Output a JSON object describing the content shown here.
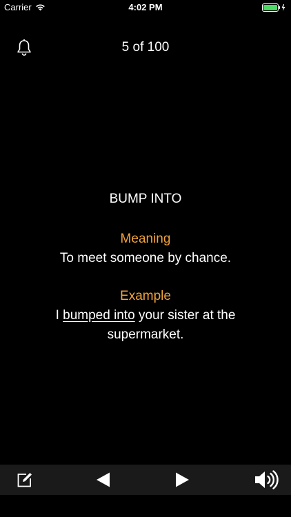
{
  "status_bar": {
    "carrier": "Carrier",
    "time": "4:02 PM",
    "battery_color": "#4cd964"
  },
  "nav": {
    "counter": "5 of 100",
    "left_icon": "bell-icon"
  },
  "card": {
    "phrase": "BUMP INTO",
    "meaning_label": "Meaning",
    "meaning_text": "To meet someone by chance.",
    "example_label": "Example",
    "example_prefix": "I ",
    "example_highlight": "bumped into",
    "example_line1_suffix": " your sister at the",
    "example_line2": "supermarket.",
    "accent_color": "#f2a33a"
  },
  "toolbar": {
    "edit_icon": "edit-icon",
    "prev_icon": "previous-icon",
    "next_icon": "next-icon",
    "speaker_icon": "speaker-icon"
  }
}
